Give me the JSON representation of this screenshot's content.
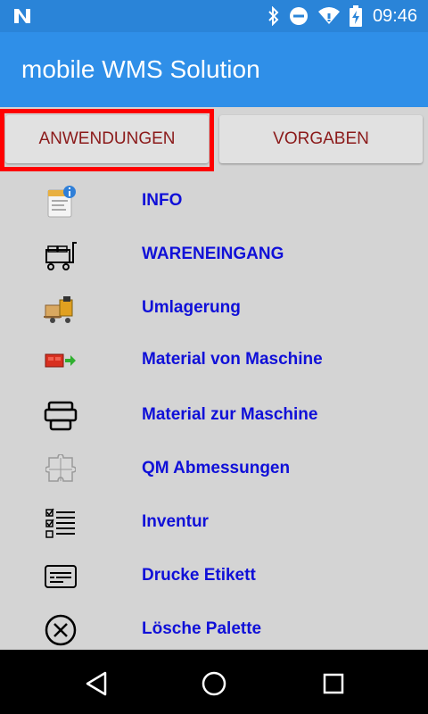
{
  "status_bar": {
    "time": "09:46",
    "icons": [
      "notification-n-icon",
      "bluetooth-icon",
      "do-not-disturb-icon",
      "wifi-icon",
      "battery-charging-icon"
    ]
  },
  "app_bar": {
    "title": "mobile WMS Solution"
  },
  "tabs": [
    {
      "label": "ANWENDUNGEN",
      "selected": true
    },
    {
      "label": "VORGABEN",
      "selected": false
    }
  ],
  "colors": {
    "app_bar": "#2f8fe8",
    "status_bar": "#2a84d8",
    "list_label": "#1010d8",
    "tab_text": "#8b1a1a",
    "highlight": "#ff0000"
  },
  "menu": [
    {
      "label": "INFO",
      "icon": "info-document-icon"
    },
    {
      "label": "WARENEINGANG",
      "icon": "cart-icon"
    },
    {
      "label": "Umlagerung",
      "icon": "forklift-icon"
    },
    {
      "label": "Material von Maschine",
      "icon": "material-from-machine-icon"
    },
    {
      "label": "Material zur Maschine",
      "icon": "machine-icon"
    },
    {
      "label": "QM Abmessungen",
      "icon": "puzzle-icon"
    },
    {
      "label": "Inventur",
      "icon": "checklist-icon"
    },
    {
      "label": "Drucke Etikett",
      "icon": "label-icon"
    },
    {
      "label": "Lösche Palette",
      "icon": "delete-circle-icon"
    }
  ],
  "nav": [
    "back-icon",
    "home-icon",
    "recents-icon"
  ]
}
